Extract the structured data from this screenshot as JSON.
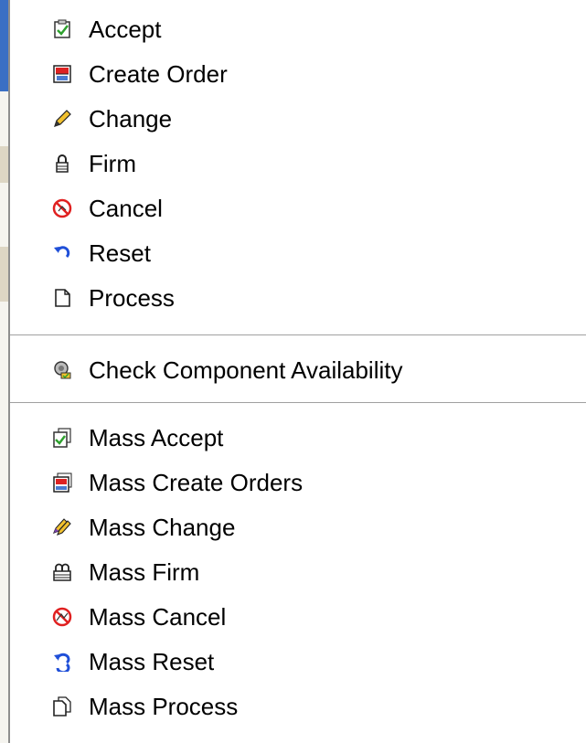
{
  "context_menu": {
    "group_1": [
      {
        "label": "Accept",
        "icon": "checklist-accept-icon"
      },
      {
        "label": "Create Order",
        "icon": "create-order-icon"
      },
      {
        "label": "Change",
        "icon": "pencil-icon"
      },
      {
        "label": "Firm",
        "icon": "lock-icon"
      },
      {
        "label": "Cancel",
        "icon": "cancel-icon"
      },
      {
        "label": "Reset",
        "icon": "undo-arrow-icon"
      },
      {
        "label": "Process",
        "icon": "document-icon"
      }
    ],
    "group_2": [
      {
        "label": "Check Component Availability",
        "icon": "component-availability-icon"
      }
    ],
    "group_3": [
      {
        "label": "Mass Accept",
        "icon": "mass-accept-icon"
      },
      {
        "label": "Mass Create Orders",
        "icon": "mass-create-orders-icon"
      },
      {
        "label": "Mass Change",
        "icon": "mass-pencil-icon"
      },
      {
        "label": "Mass Firm",
        "icon": "mass-lock-icon"
      },
      {
        "label": "Mass Cancel",
        "icon": "mass-cancel-icon"
      },
      {
        "label": "Mass Reset",
        "icon": "mass-undo-arrow-icon"
      },
      {
        "label": "Mass Process",
        "icon": "mass-document-icon"
      }
    ]
  },
  "colors": {
    "menu_background": "#ffffff",
    "separator": "#a0a0a0",
    "text": "#000000",
    "reset_arrow": "#1f4fd8",
    "cancel_red": "#e02020",
    "accept_green": "#2ea12e"
  }
}
